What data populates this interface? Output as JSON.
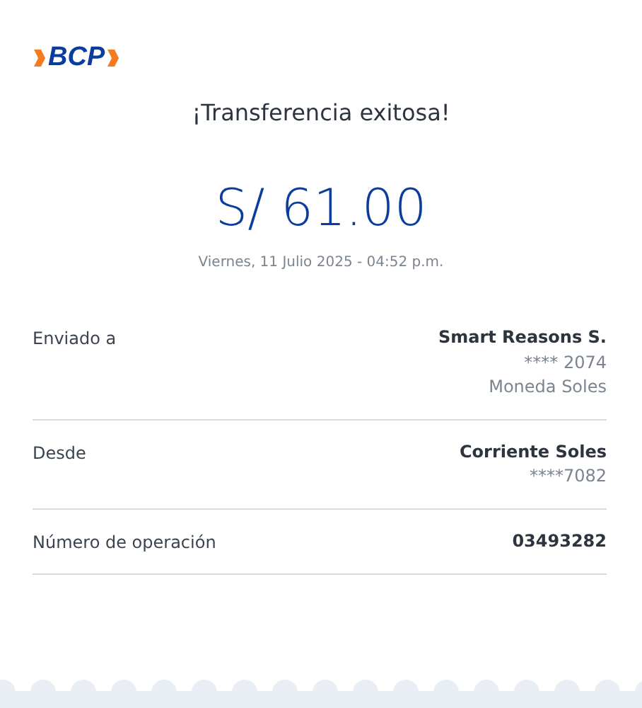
{
  "logo": {
    "text": "BCP"
  },
  "title": "¡Transferencia exitosa!",
  "amount": "S/ 61.00",
  "date": "Viernes, 11 Julio 2025 - 04:52 p.m.",
  "details": [
    {
      "label": "Enviado a",
      "values": [
        {
          "text": "Smart Reasons S.",
          "kind": "main"
        },
        {
          "text": "**** 2074",
          "kind": "detail"
        },
        {
          "text": "Moneda Soles",
          "kind": "detail"
        }
      ]
    },
    {
      "label": "Desde",
      "values": [
        {
          "text": "Corriente Soles",
          "kind": "main"
        },
        {
          "text": "****7082",
          "kind": "detail"
        }
      ]
    },
    {
      "label": "Número de operación",
      "values": [
        {
          "text": "03493282",
          "kind": "main"
        }
      ]
    }
  ]
}
